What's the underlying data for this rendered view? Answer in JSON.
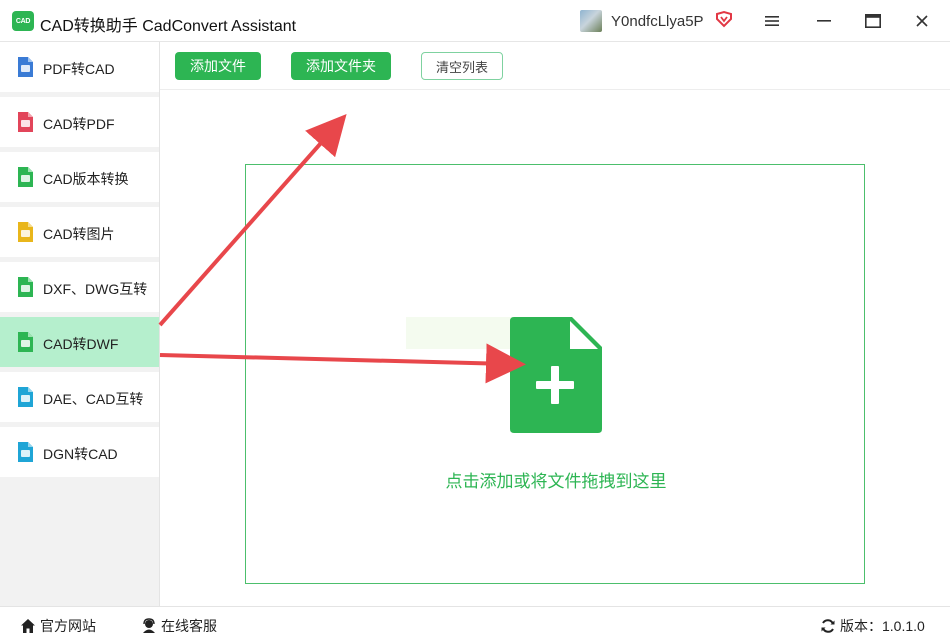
{
  "window": {
    "logo_text": "CAD",
    "title": "CAD转换助手 CadConvert Assistant",
    "user_name": "Y0ndfcLlya5P",
    "icons": [
      "menu-icon",
      "minimize-icon",
      "maximize-icon",
      "close-icon"
    ]
  },
  "sidebar": {
    "items": [
      {
        "label": "PDF转CAD",
        "icon": "pdf-to-cad-icon",
        "color": "#3a7bd5"
      },
      {
        "label": "CAD转PDF",
        "icon": "cad-to-pdf-icon",
        "color": "#e2455a"
      },
      {
        "label": "CAD版本转换",
        "icon": "cad-version-icon",
        "color": "#2db553"
      },
      {
        "label": "CAD转图片",
        "icon": "cad-to-image-icon",
        "color": "#e9b61b"
      },
      {
        "label": "DXF、DWG互转",
        "icon": "dxf-dwg-icon",
        "color": "#2db553"
      },
      {
        "label": "CAD转DWF",
        "icon": "cad-to-dwf-icon",
        "color": "#2db553"
      },
      {
        "label": "DAE、CAD互转",
        "icon": "dae-cad-icon",
        "color": "#1fa5d6"
      },
      {
        "label": "DGN转CAD",
        "icon": "dgn-to-cad-icon",
        "color": "#1fa5d6"
      }
    ],
    "active_index": 5
  },
  "toolbar": {
    "add_file": "添加文件",
    "add_folder": "添加文件夹",
    "clear_list": "清空列表"
  },
  "dropzone": {
    "hint": "点击添加或将文件拖拽到这里",
    "icon": "file-add-icon"
  },
  "statusbar": {
    "website": "官方网站",
    "service": "在线客服",
    "version": "版本：1.0.1.0"
  },
  "colors": {
    "accent": "#2db553",
    "active_bg": "#b5efcd",
    "arrow": "#e8474b"
  }
}
